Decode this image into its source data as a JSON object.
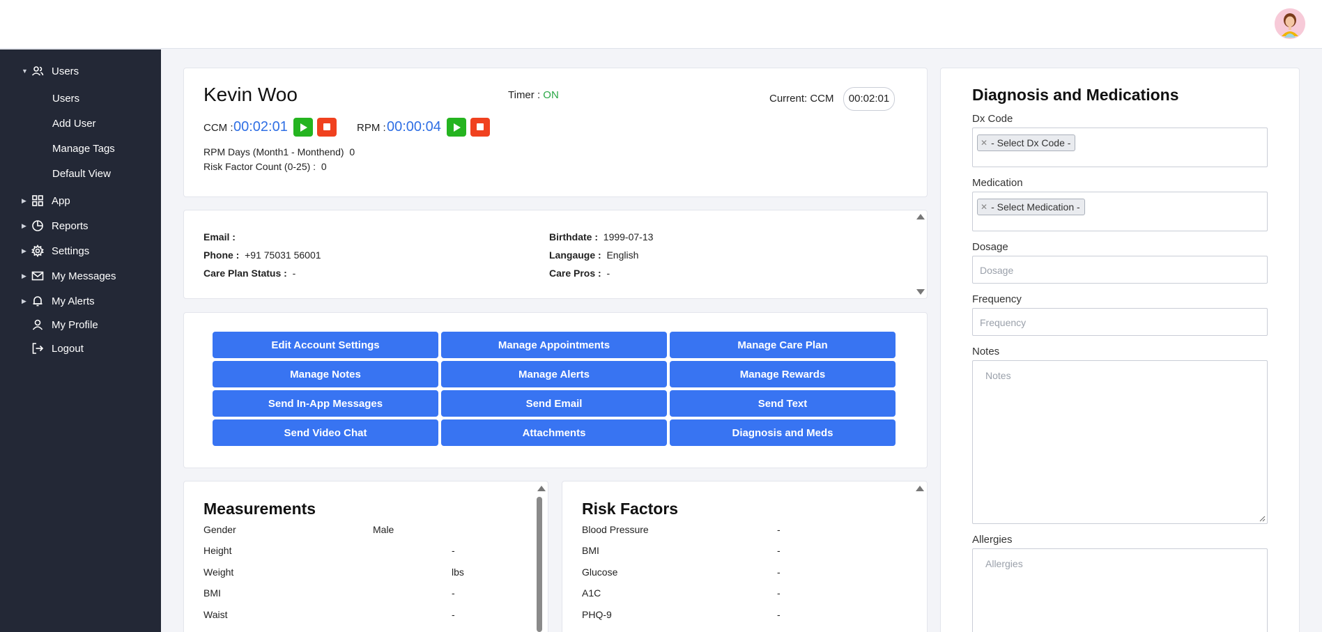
{
  "sidebar": {
    "users_group": "Users",
    "subitems": [
      "Users",
      "Add User",
      "Manage Tags",
      "Default View"
    ],
    "items": [
      {
        "label": "App",
        "icon": "grid-icon"
      },
      {
        "label": "Reports",
        "icon": "pie-chart-icon"
      },
      {
        "label": "Settings",
        "icon": "gear-icon"
      },
      {
        "label": "My Messages",
        "icon": "mail-icon"
      },
      {
        "label": "My Alerts",
        "icon": "bell-icon"
      },
      {
        "label": "My Profile",
        "icon": "user-icon"
      },
      {
        "label": "Logout",
        "icon": "logout-icon"
      }
    ]
  },
  "patient": {
    "name": "Kevin Woo",
    "timer_label": "Timer :",
    "timer_status": "ON",
    "current_label": "Current: CCM",
    "current_time": "00:02:01",
    "ccm_label": "CCM :",
    "ccm_time": "00:02:01",
    "rpm_label": "RPM :",
    "rpm_time": "00:00:04",
    "rpm_days_label": "RPM Days  (Month1 - Monthend)",
    "rpm_days_value": "0",
    "risk_label": "Risk Factor Count (0-25) :",
    "risk_value": "0"
  },
  "info": {
    "email_label": "Email :",
    "email_value": "",
    "phone_label": "Phone :",
    "phone_value": "+91 75031 56001",
    "care_plan_label": "Care Plan Status :",
    "care_plan_value": "-",
    "birthdate_label": "Birthdate :",
    "birthdate_value": "1999-07-13",
    "language_label": "Langauge :",
    "language_value": "English",
    "care_pros_label": "Care Pros :",
    "care_pros_value": "-"
  },
  "actions": [
    "Edit Account Settings",
    "Manage Appointments",
    "Manage Care Plan",
    "Manage Notes",
    "Manage Alerts",
    "Manage Rewards",
    "Send In-App Messages",
    "Send Email",
    "Send Text",
    "Send Video Chat",
    "Attachments",
    "Diagnosis and Meds"
  ],
  "measurements": {
    "title": "Measurements",
    "rows": [
      {
        "label": "Gender",
        "value": "Male",
        "unit": ""
      },
      {
        "label": "Height",
        "value": "",
        "unit": "-"
      },
      {
        "label": "Weight",
        "value": "",
        "unit": "lbs"
      },
      {
        "label": "BMI",
        "value": "",
        "unit": "-"
      },
      {
        "label": "Waist",
        "value": "",
        "unit": "-"
      }
    ]
  },
  "risk_factors": {
    "title": "Risk Factors",
    "rows": [
      {
        "label": "Blood Pressure",
        "value": "-"
      },
      {
        "label": "BMI",
        "value": "-"
      },
      {
        "label": "Glucose",
        "value": "-"
      },
      {
        "label": "A1C",
        "value": "-"
      },
      {
        "label": "PHQ-9",
        "value": "-"
      }
    ]
  },
  "dx_panel": {
    "title": "Diagnosis and Medications",
    "dx_label": "Dx Code",
    "dx_chip": "- Select Dx Code -",
    "med_label": "Medication",
    "med_chip": "- Select Medication -",
    "dosage_label": "Dosage",
    "dosage_placeholder": "Dosage",
    "frequency_label": "Frequency",
    "frequency_placeholder": "Frequency",
    "notes_label": "Notes",
    "notes_placeholder": "Notes",
    "allergies_label": "Allergies",
    "allergies_placeholder": "Allergies"
  },
  "colors": {
    "sidebar_bg": "#232836",
    "action_blue": "#3874f2",
    "play_green": "#25b420",
    "stop_red": "#f0411f",
    "timer_blue": "#2f6fe4"
  }
}
